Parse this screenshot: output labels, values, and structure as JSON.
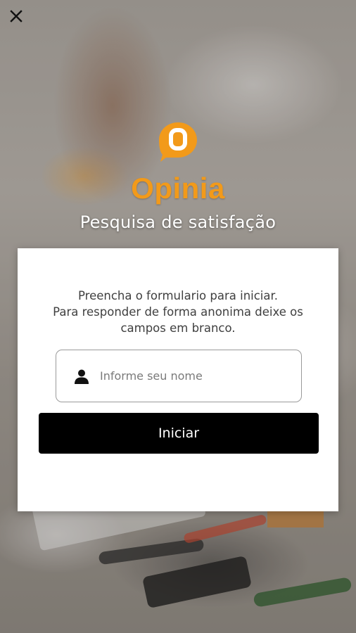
{
  "header": {
    "close_icon": "close-icon"
  },
  "brand": {
    "name": "Opinia",
    "color": "#f29a1a",
    "logo_icon": "speech-bubble-o-icon"
  },
  "subtitle": "Pesquisa de satisfação",
  "form": {
    "intro_line1": "Preencha o formulario para iniciar.",
    "intro_line2": "Para responder de forma anonima deixe os",
    "intro_line3": "campos em branco.",
    "name_input": {
      "placeholder": "Informe seu nome",
      "value": "",
      "icon": "user-icon"
    },
    "submit_label": "Iniciar"
  }
}
